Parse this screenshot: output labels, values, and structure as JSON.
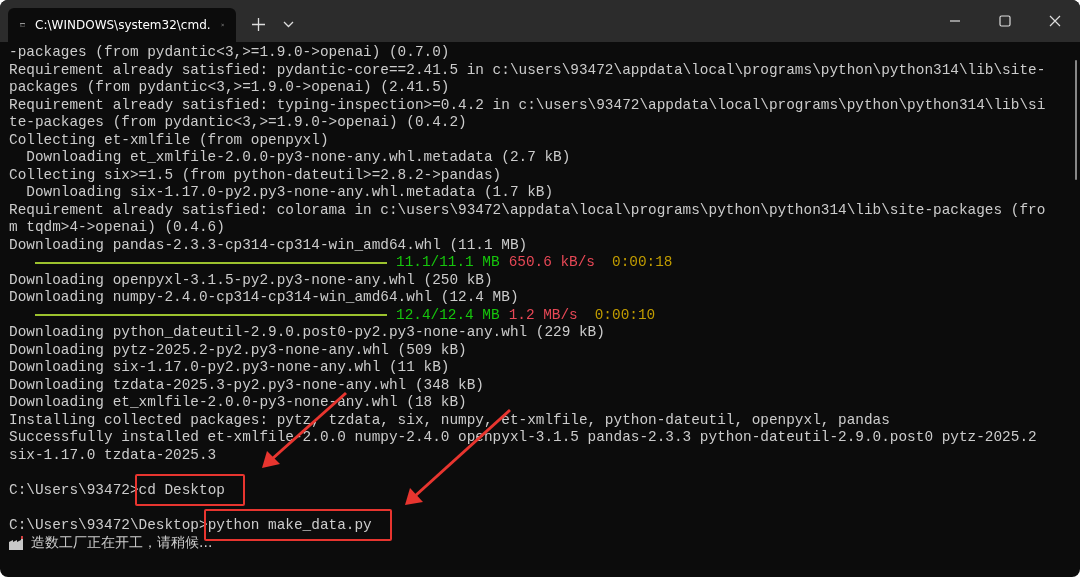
{
  "window": {
    "tab_title": "C:\\WINDOWS\\system32\\cmd."
  },
  "lines": [
    {
      "kind": "text",
      "text": "-packages (from pydantic<3,>=1.9.0->openai) (0.7.0)"
    },
    {
      "kind": "text",
      "text": "Requirement already satisfied: pydantic-core==2.41.5 in c:\\users\\93472\\appdata\\local\\programs\\python\\python314\\lib\\site-"
    },
    {
      "kind": "text",
      "text": "packages (from pydantic<3,>=1.9.0->openai) (2.41.5)"
    },
    {
      "kind": "text",
      "text": "Requirement already satisfied: typing-inspection>=0.4.2 in c:\\users\\93472\\appdata\\local\\programs\\python\\python314\\lib\\si"
    },
    {
      "kind": "text",
      "text": "te-packages (from pydantic<3,>=1.9.0->openai) (0.4.2)"
    },
    {
      "kind": "text",
      "text": "Collecting et-xmlfile (from openpyxl)"
    },
    {
      "kind": "text",
      "text": "  Downloading et_xmlfile-2.0.0-py3-none-any.whl.metadata (2.7 kB)"
    },
    {
      "kind": "text",
      "text": "Collecting six>=1.5 (from python-dateutil>=2.8.2->pandas)"
    },
    {
      "kind": "text",
      "text": "  Downloading six-1.17.0-py2.py3-none-any.whl.metadata (1.7 kB)"
    },
    {
      "kind": "text",
      "text": "Requirement already satisfied: colorama in c:\\users\\93472\\appdata\\local\\programs\\python\\python314\\lib\\site-packages (fro"
    },
    {
      "kind": "text",
      "text": "m tqdm>4->openai) (0.4.6)"
    },
    {
      "kind": "text",
      "text": "Downloading pandas-2.3.3-cp314-cp314-win_amd64.whl (11.1 MB)"
    },
    {
      "kind": "progress",
      "level": 1,
      "amount": "11.1/11.1 MB",
      "speed": "650.6 kB/s",
      "eta": "0:00:18"
    },
    {
      "kind": "text",
      "text": "Downloading openpyxl-3.1.5-py2.py3-none-any.whl (250 kB)"
    },
    {
      "kind": "text",
      "text": "Downloading numpy-2.4.0-cp314-cp314-win_amd64.whl (12.4 MB)"
    },
    {
      "kind": "progress",
      "level": 1,
      "amount": "12.4/12.4 MB",
      "speed": "1.2 MB/s",
      "eta": "0:00:10"
    },
    {
      "kind": "text",
      "text": "Downloading python_dateutil-2.9.0.post0-py2.py3-none-any.whl (229 kB)"
    },
    {
      "kind": "text",
      "text": "Downloading pytz-2025.2-py2.py3-none-any.whl (509 kB)"
    },
    {
      "kind": "text",
      "text": "Downloading six-1.17.0-py2.py3-none-any.whl (11 kB)"
    },
    {
      "kind": "text",
      "text": "Downloading tzdata-2025.3-py2.py3-none-any.whl (348 kB)"
    },
    {
      "kind": "text",
      "text": "Downloading et_xmlfile-2.0.0-py3-none-any.whl (18 kB)"
    },
    {
      "kind": "text",
      "text": "Installing collected packages: pytz, tzdata, six, numpy, et-xmlfile, python-dateutil, openpyxl, pandas"
    },
    {
      "kind": "text",
      "text": "Successfully installed et-xmlfile-2.0.0 numpy-2.4.0 openpyxl-3.1.5 pandas-2.3.3 python-dateutil-2.9.0.post0 pytz-2025.2"
    },
    {
      "kind": "text",
      "text": "six-1.17.0 tzdata-2025.3"
    },
    {
      "kind": "blank"
    },
    {
      "kind": "prompt",
      "prompt": "C:\\Users\\93472>",
      "command": "cd Desktop",
      "highlighted": true
    },
    {
      "kind": "blank"
    },
    {
      "kind": "prompt",
      "prompt": "C:\\Users\\93472\\Desktop>",
      "command": "python make_data.py",
      "highlighted": true
    },
    {
      "kind": "status",
      "text": "造数工厂正在开工，请稍候..."
    }
  ]
}
